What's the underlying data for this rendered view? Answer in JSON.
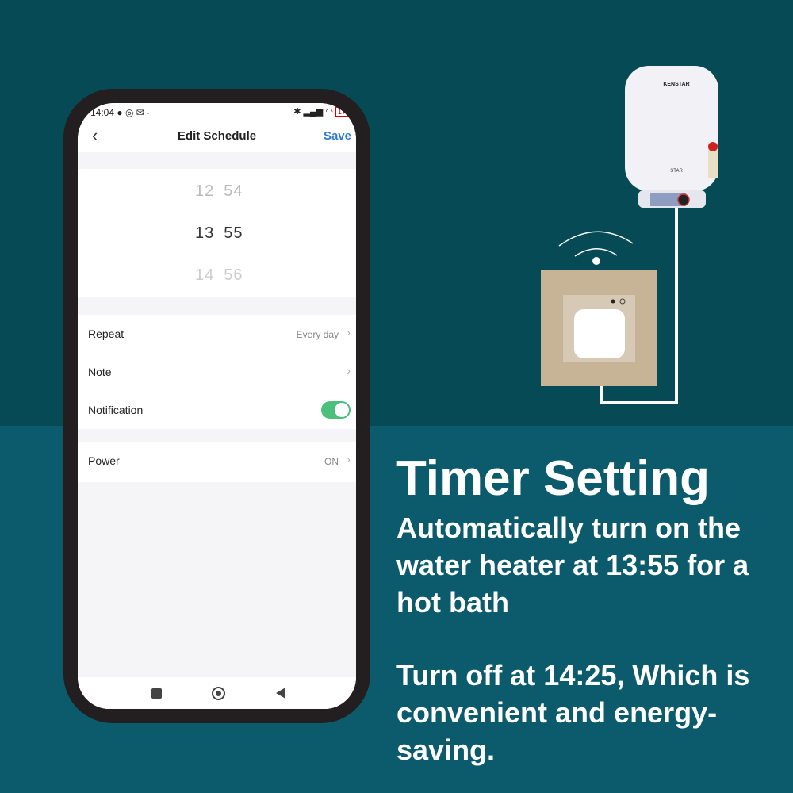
{
  "status_bar": {
    "time": "14:04",
    "icons": [
      "chat-icon",
      "instagram-icon",
      "gmail-icon",
      "bluetooth-icon",
      "signal-icon",
      "wifi-icon",
      "battery-icon"
    ],
    "battery": "17"
  },
  "header": {
    "title": "Edit Schedule",
    "save_label": "Save",
    "back_icon": "chevron-left-icon"
  },
  "picker": {
    "rows": [
      {
        "hour": "12",
        "minute": "54"
      },
      {
        "hour": "13",
        "minute": "55"
      },
      {
        "hour": "14",
        "minute": "56"
      }
    ]
  },
  "settings": {
    "repeat": {
      "label": "Repeat",
      "value": "Every day"
    },
    "note": {
      "label": "Note"
    },
    "notification": {
      "label": "Notification",
      "enabled": true
    },
    "power": {
      "label": "Power",
      "value": "ON"
    }
  },
  "heater": {
    "brand": "KENSTAR",
    "model": "STAR"
  },
  "marketing": {
    "title": "Timer Setting",
    "line1": "Automatically turn on the water heater at 13:55 for a hot bath",
    "line2": "Turn off at 14:25, Which is convenient and energy-saving."
  },
  "colors": {
    "accent": "#2f7ad6",
    "toggle": "#4cbf7a",
    "bg_top": "#064a56",
    "bg_bottom": "#0b5b6c"
  }
}
